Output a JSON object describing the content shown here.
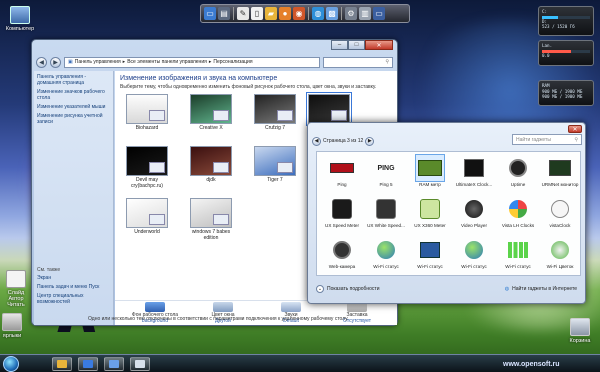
{
  "desktop": {
    "icons": [
      {
        "label": "Компьютер"
      },
      {
        "label": "Слайд\nАвтор\nЧитать"
      },
      {
        "label": "ярлыки"
      },
      {
        "label": "Корзина"
      }
    ]
  },
  "gadgets_side": [
    {
      "line1": "C:",
      "line2": "D:",
      "line3": "523 / 1520 Гб"
    },
    {
      "line1": "Lan.",
      "line2": "0.0",
      "line3": "1.7"
    },
    {
      "line1": "RAM",
      "line2": "900 МБ / 1900 МБ",
      "line3": "900 МБ / 1900 МБ"
    }
  ],
  "control_panel": {
    "breadcrumb": [
      "Панель управления",
      "Все элементы панели управления",
      "Персонализация"
    ],
    "search_placeholder": "",
    "left_links": [
      "Панель управления - домашняя страница",
      "Изменение значков рабочего стола",
      "Изменение указателей мыши",
      "Изменение рисунка учетной записи"
    ],
    "see_also_title": "См. также",
    "see_also_links": [
      "Экран",
      "Панель задач и меню Пуск",
      "Центр специальных возможностей"
    ],
    "heading": "Изменение изображения и звука на компьютере",
    "description": "Выберите тему, чтобы одновременно изменить фоновый рисунок рабочего стола, цвет окна, звуки и заставку.",
    "themes": [
      {
        "name": "Biohazard"
      },
      {
        "name": "Creative X"
      },
      {
        "name": "Crufzig 7"
      },
      {
        "name": ""
      },
      {
        "name": "Devil may cry(bachpc.ru)"
      },
      {
        "name": "djdk"
      },
      {
        "name": "Tiger 7"
      },
      {
        "name": "Underworld"
      },
      {
        "name": "windows 7 babes edition"
      }
    ],
    "bottom_options": [
      {
        "title": "Фон рабочего стола",
        "value": "background"
      },
      {
        "title": "Цвет окна",
        "value": "Другой"
      },
      {
        "title": "Звуки",
        "value": "Default"
      },
      {
        "title": "Заставка",
        "value": "Отсутствует"
      }
    ],
    "status": "Одно или несколько тем отключены в соответствии с параметрами подключения к удаленному рабочему столу."
  },
  "gadget_gallery": {
    "page_label": "Страница 3 из 12",
    "search_placeholder": "Найти гаджеты",
    "gadgets": [
      {
        "name": "Ping"
      },
      {
        "name": "Ping 5"
      },
      {
        "name": "RAM метр"
      },
      {
        "name": "UltimateX Clock..."
      },
      {
        "name": "Uptime"
      },
      {
        "name": "URMNet монитор"
      },
      {
        "name": "UX Speed Meter"
      },
      {
        "name": "UX White Speed..."
      },
      {
        "name": "UX X360 Meter"
      },
      {
        "name": "Video Player"
      },
      {
        "name": "Vista LH Clocks"
      },
      {
        "name": "vistaClock"
      },
      {
        "name": "Web-камера"
      },
      {
        "name": "Wi-Fi статус"
      },
      {
        "name": "Wi-Fi статус"
      },
      {
        "name": "Wi-Fi статус"
      },
      {
        "name": "Wi-Fi статус"
      },
      {
        "name": "Wi-Fi Цветок"
      }
    ],
    "footer_left": "Показать подробности",
    "footer_right": "Найти гаджеты в Интернете"
  },
  "dock_label": "PING",
  "watermark": "www.opensoft.ru",
  "colors": {
    "accent": "#1e3f8a",
    "link": "#15407a",
    "taskbar": "#1a2435"
  }
}
